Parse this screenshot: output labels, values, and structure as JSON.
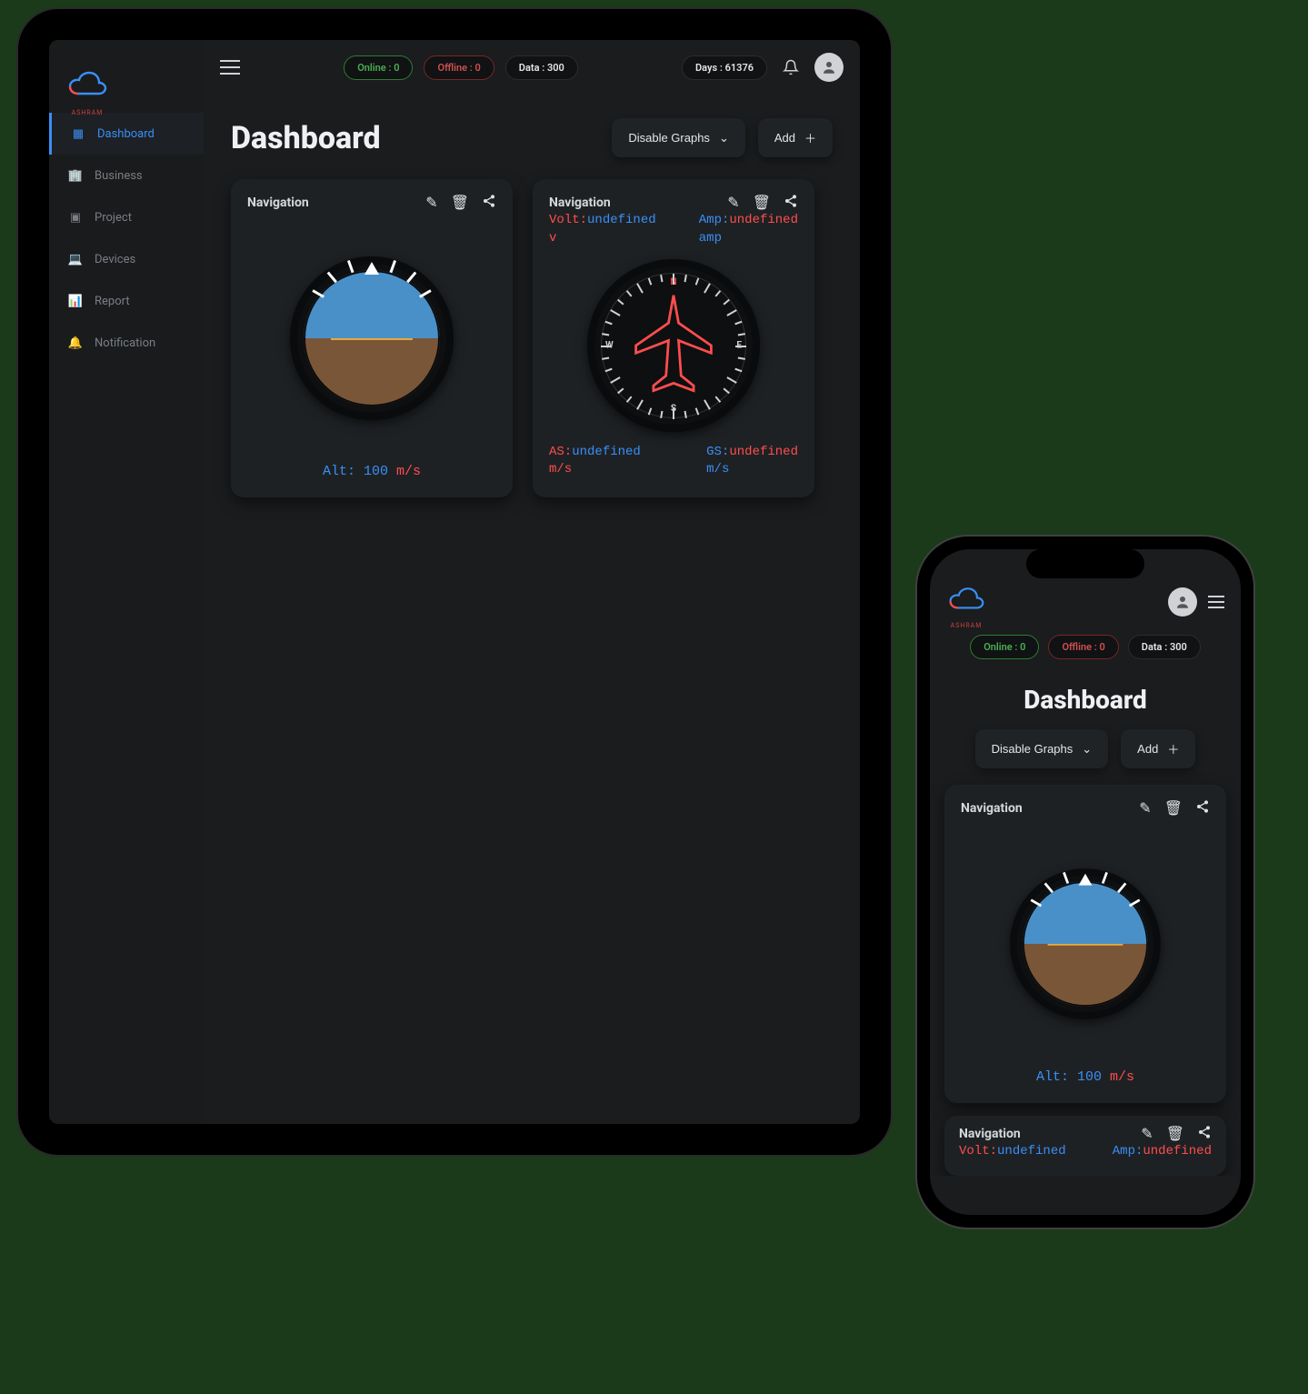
{
  "header": {
    "status": {
      "online_label": "Online : ",
      "online_value": "0",
      "offline_label": "Offline : ",
      "offline_value": "0",
      "data_label": "Data : ",
      "data_value": "300",
      "days_label": "Days : ",
      "days_value": "61376"
    }
  },
  "sidebar": {
    "items": [
      {
        "label": "Dashboard",
        "icon": "grid-icon",
        "active": true
      },
      {
        "label": "Business",
        "icon": "building-icon",
        "active": false
      },
      {
        "label": "Project",
        "icon": "project-icon",
        "active": false
      },
      {
        "label": "Devices",
        "icon": "devices-icon",
        "active": false
      },
      {
        "label": "Report",
        "icon": "report-icon",
        "active": false
      },
      {
        "label": "Notification",
        "icon": "bell-icon",
        "active": false
      }
    ]
  },
  "page": {
    "title": "Dashboard",
    "disable_graphs_label": "Disable Graphs",
    "add_label": "Add"
  },
  "cards": {
    "attitude": {
      "title": "Navigation",
      "footer_prefix": "Alt: ",
      "footer_value": "100 ",
      "footer_unit": "m/s"
    },
    "compass": {
      "title": "Navigation",
      "volt_label": "Volt:",
      "volt_value": "undefined",
      "volt_unit": "v",
      "amp_label": "Amp:",
      "amp_value": "undefined",
      "amp_unit": "amp",
      "as_label": "AS:",
      "as_value": "undefined",
      "as_unit": "m/s",
      "gs_label": "GS:",
      "gs_value": "undefined",
      "gs_unit": "m/s"
    }
  },
  "brand": {
    "name": "ASHRAM"
  },
  "colors": {
    "accent_blue": "#3a8ff5",
    "accent_red": "#ff4d4d",
    "online": "#4caf50",
    "offline": "#d05050"
  }
}
